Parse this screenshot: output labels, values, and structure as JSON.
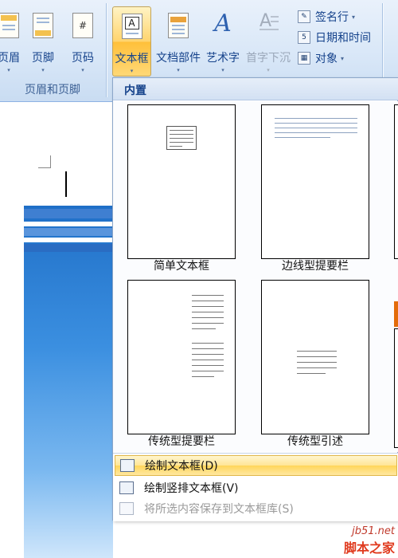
{
  "ribbon": {
    "header_footer_group": {
      "label": "页眉和页脚",
      "buttons": [
        {
          "label": "页眉",
          "icon": "header-icon"
        },
        {
          "label": "页脚",
          "icon": "footer-icon"
        },
        {
          "label": "页码",
          "icon": "page-number-icon",
          "glyph": "#"
        }
      ]
    },
    "text_group": {
      "buttons": [
        {
          "label": "文本框",
          "icon": "textbox-icon",
          "glyph": "A",
          "active": true
        },
        {
          "label": "文档部件",
          "icon": "quick-parts-icon"
        },
        {
          "label": "艺术字",
          "icon": "wordart-icon",
          "glyph": "A"
        },
        {
          "label": "首字下沉",
          "icon": "drop-cap-icon",
          "glyph": "A",
          "disabled": true
        }
      ],
      "small_buttons": [
        {
          "label": "签名行",
          "icon": "signature-line-icon",
          "caret": "▾"
        },
        {
          "label": "日期和时间",
          "icon": "date-time-icon",
          "glyph": "5"
        },
        {
          "label": "对象",
          "icon": "object-icon",
          "caret": "▾"
        }
      ]
    },
    "arrow_glyph": "▾"
  },
  "panel": {
    "header": "内置",
    "gallery": [
      {
        "label": "简单文本框"
      },
      {
        "label": "边线型提要栏"
      },
      {
        "label": "传统型提要栏"
      },
      {
        "label": "传统型引述"
      }
    ],
    "menu": [
      {
        "label": "绘制文本框(D)",
        "hover": true
      },
      {
        "label": "绘制竖排文本框(V)"
      },
      {
        "label": "将所选内容保存到文本框库(S)",
        "disabled": true
      }
    ]
  },
  "watermark": {
    "line1": "jb51.net",
    "line2": "脚本之家"
  },
  "colors": {
    "ribbon_bg": "#d7e6f7",
    "active_button": "#ffc03a",
    "ribbon_text": "#15428b",
    "cover_blue": "#1f6fc7"
  }
}
